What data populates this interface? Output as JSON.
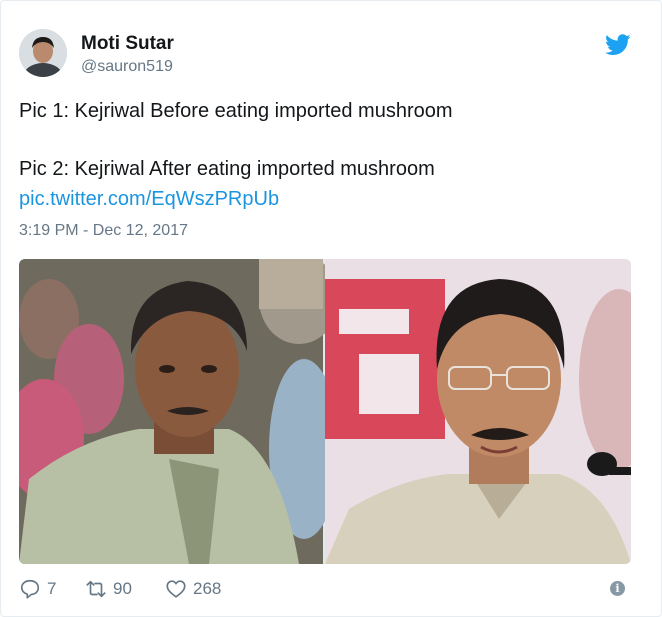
{
  "tweet": {
    "author": {
      "display_name": "Moti Sutar",
      "handle": "@sauron519"
    },
    "text_line_1": "Pic 1: Kejriwal Before eating imported mushroom",
    "text_line_2": "Pic 2: Kejriwal After eating imported mushroom",
    "link": "pic.twitter.com/EqWszPRpUb",
    "timestamp": "3:19 PM - Dec 12, 2017",
    "media": {
      "image_count": 2,
      "images": [
        {
          "role": "photo-before"
        },
        {
          "role": "photo-after"
        }
      ]
    },
    "actions": {
      "replies": "7",
      "retweets": "90",
      "likes": "268"
    }
  },
  "colors": {
    "link": "#1b95e0",
    "secondary_text": "#657786",
    "twitter_blue": "#1da1f2"
  },
  "icons": [
    "twitter-bird-icon",
    "reply-icon",
    "retweet-icon",
    "like-icon",
    "info-icon"
  ]
}
